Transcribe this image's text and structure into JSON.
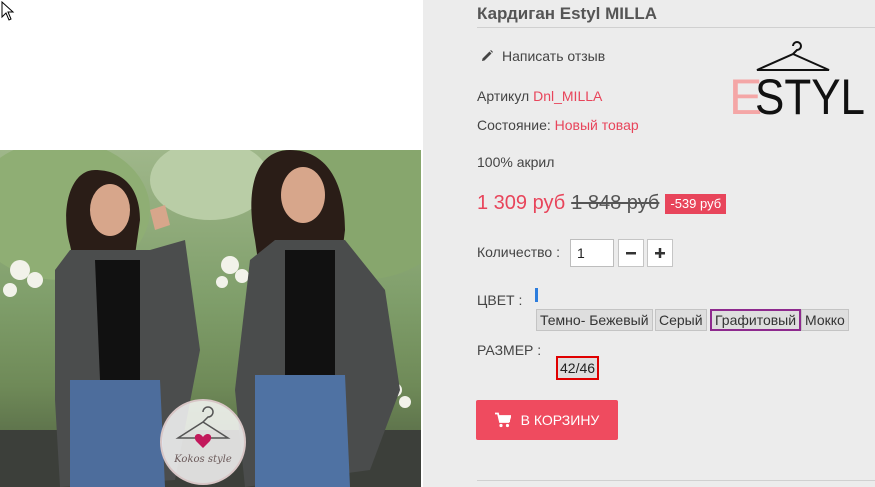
{
  "product": {
    "title": "Кардиган Estyl MILLA",
    "review_link": "Написать отзыв",
    "article_label": "Артикул",
    "article_value": "Dnl_MILLA",
    "condition_label": "Состояние:",
    "condition_value": "Новый товар",
    "composition": "100% акрил"
  },
  "brand": {
    "logo_text": "ESTYL",
    "logo_accent_letter": "E",
    "accent_color": "#f4a6a6"
  },
  "price": {
    "current": "1 309 руб",
    "old": "1 848 руб",
    "discount": "-539 руб",
    "accent_color": "#e8455b"
  },
  "quantity": {
    "label": "Количество :",
    "value": "1"
  },
  "color": {
    "label": "ЦВЕТ :",
    "options": [
      "Темно- Бежевый",
      "Серый",
      "Графитовый",
      "Мокко"
    ],
    "selected": "Графитовый"
  },
  "size": {
    "label": "РАЗМЕР :",
    "options": [
      "42/46"
    ],
    "selected": "42/46"
  },
  "cart": {
    "button_label": "В КОРЗИНУ",
    "button_color": "#ef4b5f"
  },
  "watermark": {
    "text": "Kokos style"
  },
  "icons": [
    "cursor-icon",
    "pencil-icon",
    "minus-icon",
    "plus-icon",
    "cart-icon",
    "hanger-icon",
    "heart-icon"
  ]
}
